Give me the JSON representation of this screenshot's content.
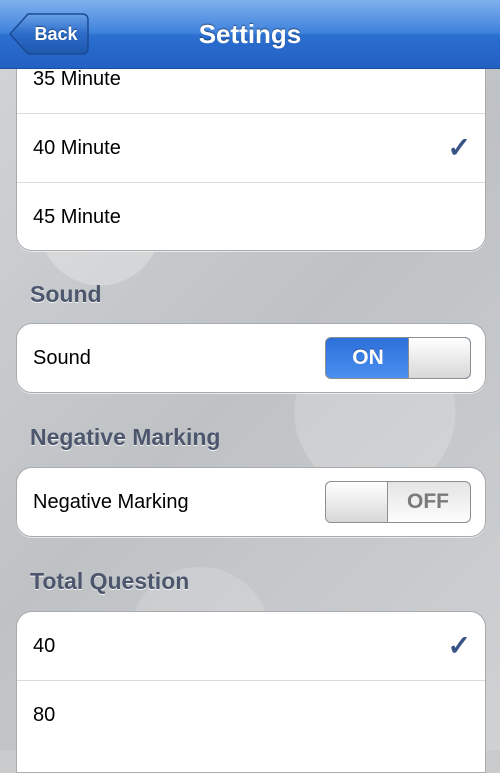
{
  "navbar": {
    "title": "Settings",
    "back_label": "Back"
  },
  "time_options": [
    {
      "label": "35 Minute",
      "selected": false
    },
    {
      "label": "40 Minute",
      "selected": true
    },
    {
      "label": "45 Minute",
      "selected": false
    }
  ],
  "sound": {
    "section_title": "Sound",
    "label": "Sound",
    "state": "ON"
  },
  "negative_marking": {
    "section_title": "Negative Marking",
    "label": "Negative Marking",
    "state": "OFF"
  },
  "total_question": {
    "section_title": "Total Question",
    "options": [
      {
        "label": "40",
        "selected": true
      },
      {
        "label": "80",
        "selected": false
      }
    ]
  },
  "checkmark_glyph": "✓",
  "colors": {
    "navbar_blue": "#2b6fd0",
    "toggle_on_blue": "#3a7fe6",
    "checkmark": "#385487",
    "section_title": "#4c566c"
  }
}
